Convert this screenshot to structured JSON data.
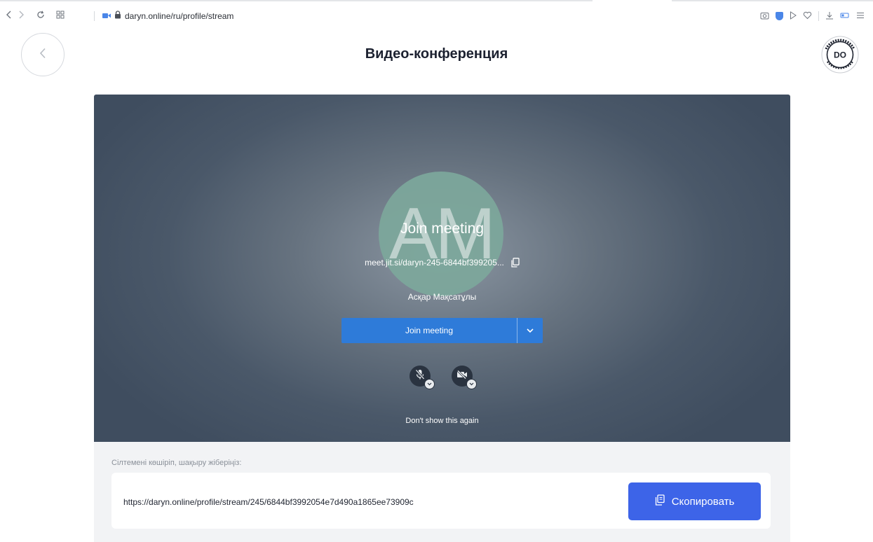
{
  "browser": {
    "url": "daryn.online/ru/profile/stream"
  },
  "header": {
    "title": "Видео-конференция",
    "logo_text": "DO",
    "logo_ring_text": "ДАРЫНДЫ ОҚУШЫ DARYN.ONLINE"
  },
  "jitsi": {
    "avatar_initials": "AM",
    "join_title": "Join meeting",
    "meeting_url": "meet.jit.si/daryn-245-6844bf399205...",
    "user_name": "Асқар Мақсатұлы",
    "join_button_label": "Join meeting",
    "dont_show_label": "Don't show this again"
  },
  "share": {
    "label": "Сілтемені көшіріп, шақыру жіберіңіз:",
    "link": "https://daryn.online/profile/stream/245/6844bf3992054e7d490a1865ee73909c",
    "copy_button_label": "Скопировать"
  },
  "colors": {
    "accent": "#3d64e8",
    "jitsi_button": "#2e7bd9",
    "avatar": "#7da89c"
  }
}
